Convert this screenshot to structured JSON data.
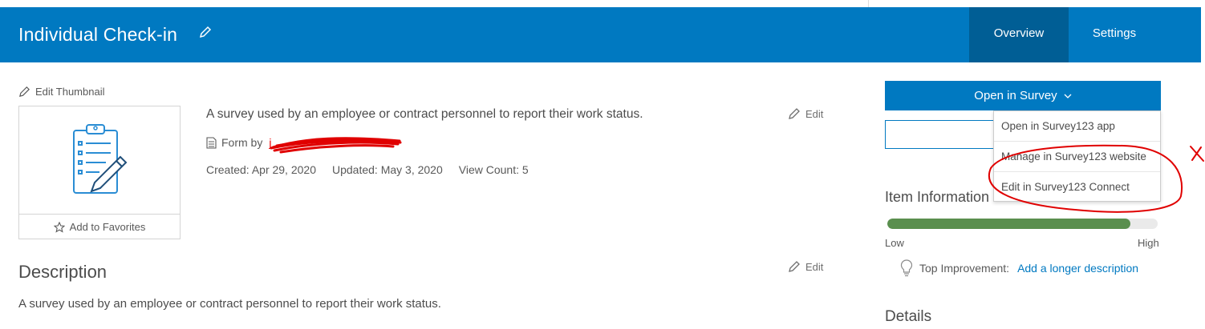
{
  "header": {
    "title": "Individual Check-in",
    "tabs": [
      {
        "label": "Overview",
        "active": true
      },
      {
        "label": "Settings",
        "active": false
      }
    ],
    "color": "#0079c1",
    "active_tab_color": "#005e95"
  },
  "thumbnail": {
    "edit_label": "Edit Thumbnail",
    "favorites_label": "Add to Favorites",
    "icon": "clipboard-pencil-icon"
  },
  "summary": {
    "text": "A survey used by an employee or contract personnel to report their work status.",
    "type_prefix": "Form by",
    "owner": "j",
    "created": "Created: Apr 29, 2020",
    "updated": "Updated: May 3, 2020",
    "views": "View Count: 5",
    "edit_label": "Edit"
  },
  "description": {
    "heading": "Description",
    "text": "A survey used by an employee or contract personnel to report their work status.",
    "edit_label": "Edit"
  },
  "sidebar": {
    "open_button": "Open in Survey",
    "dropdown": [
      "Open in Survey123 app",
      "Manage in Survey123 website",
      "Edit in Survey123 Connect"
    ],
    "item_info_heading": "Item Information",
    "progress": 0.9,
    "low_label": "Low",
    "high_label": "High",
    "top_improvement_label": "Top Improvement:",
    "top_improvement_link": "Add a longer description",
    "details_heading": "Details",
    "progress_color": "#5a8f4e"
  },
  "annotation": {
    "mark": "X",
    "color": "#e00000"
  }
}
